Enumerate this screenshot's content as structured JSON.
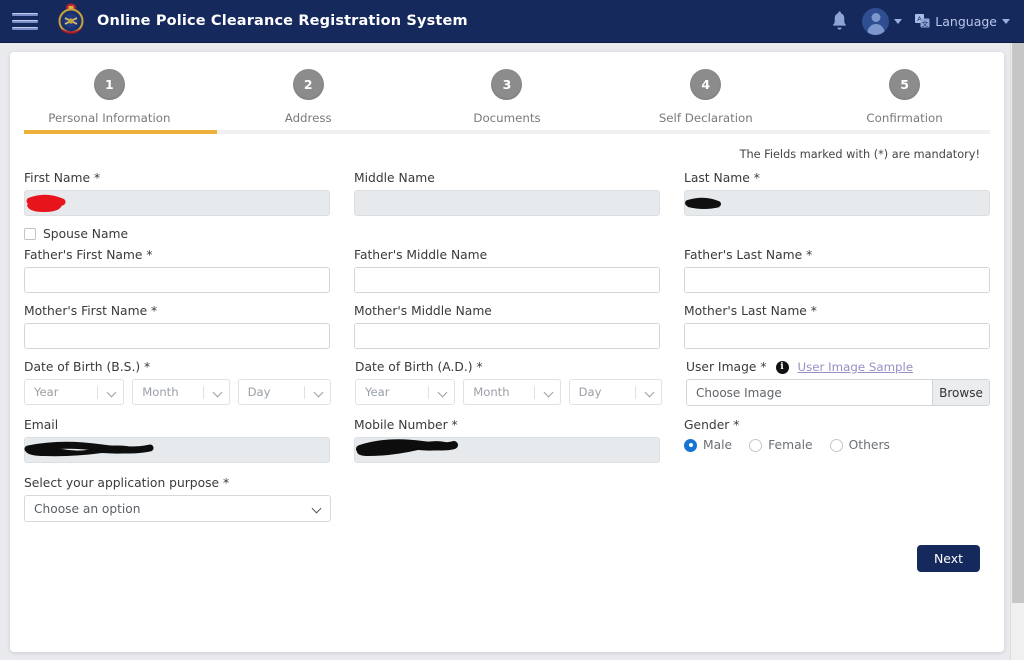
{
  "header": {
    "menu_icon": "hamburger-menu-icon",
    "logo_icon": "nepal-police-emblem",
    "title": "Online Police Clearance Registration System",
    "bell_icon": "notification-bell-icon",
    "avatar_icon": "user-avatar",
    "language_label": "Language",
    "language_icon": "translate-icon",
    "brand_color": "#16295c"
  },
  "stepper": {
    "accent_color": "#efb03c",
    "active_index": 1,
    "progress_percent": 20,
    "steps": [
      {
        "number": "1",
        "label": "Personal Information"
      },
      {
        "number": "2",
        "label": "Address"
      },
      {
        "number": "3",
        "label": "Documents"
      },
      {
        "number": "4",
        "label": "Self Declaration"
      },
      {
        "number": "5",
        "label": "Confirmation"
      }
    ]
  },
  "form": {
    "mandatory_note": "The Fields marked with (*) are mandatory!",
    "first_name": {
      "label": "First Name *",
      "value": "",
      "redacted": true
    },
    "middle_name": {
      "label": "Middle Name",
      "value": ""
    },
    "last_name": {
      "label": "Last Name *",
      "value": "",
      "redacted": true
    },
    "spouse_name": {
      "label": "Spouse Name",
      "checked": false
    },
    "father_first_name": {
      "label": "Father's First Name *",
      "value": ""
    },
    "father_middle_name": {
      "label": "Father's Middle Name",
      "value": ""
    },
    "father_last_name": {
      "label": "Father's Last Name *",
      "value": ""
    },
    "mother_first_name": {
      "label": "Mother's First Name *",
      "value": ""
    },
    "mother_middle_name": {
      "label": "Mother's Middle Name",
      "value": ""
    },
    "mother_last_name": {
      "label": "Mother's Last Name *",
      "value": ""
    },
    "dob_bs": {
      "label": "Date of Birth (B.S.) *",
      "year": "Year",
      "month": "Month",
      "day": "Day"
    },
    "dob_ad": {
      "label": "Date of Birth (A.D.) *",
      "year": "Year",
      "month": "Month",
      "day": "Day"
    },
    "user_image": {
      "label": "User Image *",
      "info_icon": "info-icon",
      "sample_link": "User Image Sample",
      "placeholder": "Choose Image",
      "browse_label": "Browse"
    },
    "email": {
      "label": "Email",
      "value": "",
      "redacted": true
    },
    "mobile_number": {
      "label": "Mobile Number *",
      "value": "",
      "redacted": true
    },
    "gender": {
      "label": "Gender *",
      "selected": "Male",
      "options": [
        "Male",
        "Female",
        "Others"
      ]
    },
    "application_purpose": {
      "label": "Select your application purpose *",
      "selected": "Choose an option"
    },
    "next_button": "Next"
  }
}
